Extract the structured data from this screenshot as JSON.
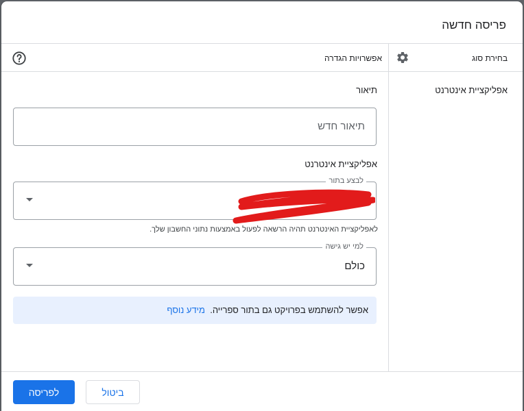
{
  "dialog": {
    "title": "פריסה חדשה"
  },
  "type_panel": {
    "header_label": "בחירת סוג",
    "items": [
      {
        "label": "אפליקציית אינטרנט"
      }
    ]
  },
  "config_panel": {
    "header_label": "אפשרויות הגדרה",
    "description": {
      "section_label": "תיאור",
      "placeholder": "תיאור חדש"
    },
    "web_app": {
      "section_label": "אפליקציית אינטרנט",
      "execute_as_label": "לבצע בתור",
      "execute_as_value": "",
      "execute_as_helper": "לאפליקציית האינטרנט תהיה הרשאה לפעול באמצעות נתוני החשבון שלך.",
      "access_label": "למי יש גישה",
      "access_value": "כולם"
    },
    "info": {
      "text": "אפשר להשתמש בפרויקט גם בתור ספרייה.",
      "link": "מידע נוסף"
    }
  },
  "footer": {
    "deploy_label": "לפריסה",
    "cancel_label": "ביטול"
  },
  "colors": {
    "primary": "#1a73e8",
    "info_bg": "#e8f0fe",
    "redaction": "#e21b1b"
  },
  "icons": [
    "gear-icon",
    "help-icon",
    "dropdown-arrow-icon"
  ]
}
